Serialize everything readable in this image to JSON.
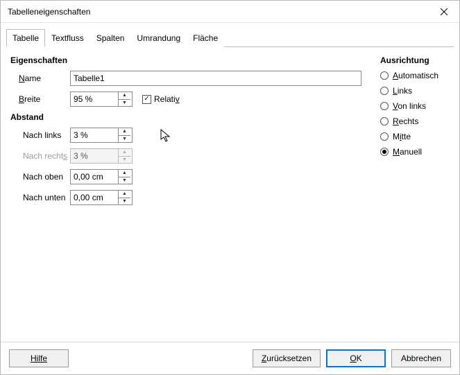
{
  "window": {
    "title": "Tabelleneigenschaften"
  },
  "tabs": {
    "items": [
      "Tabelle",
      "Textfluss",
      "Spalten",
      "Umrandung",
      "Fläche"
    ],
    "active_index": 0
  },
  "properties": {
    "section": "Eigenschaften",
    "name": {
      "label": "Name",
      "value": "Tabelle1"
    },
    "width": {
      "label": "Breite",
      "value": "95 %"
    },
    "relative": {
      "label": "Relativ",
      "checked": true
    }
  },
  "spacing": {
    "section": "Abstand",
    "left": {
      "label": "Nach links",
      "value": "3 %"
    },
    "right": {
      "label": "Nach rechts",
      "value": "3 %",
      "disabled": true
    },
    "above": {
      "label": "Nach oben",
      "value": "0,00 cm"
    },
    "below": {
      "label": "Nach unten",
      "value": "0,00 cm"
    }
  },
  "alignment": {
    "section": "Ausrichtung",
    "options": [
      "Automatisch",
      "Links",
      "Von links",
      "Rechts",
      "Mitte",
      "Manuell"
    ],
    "selected_index": 5
  },
  "buttons": {
    "help": "Hilfe",
    "reset": "Zurücksetzen",
    "ok": "OK",
    "cancel": "Abbrechen"
  }
}
